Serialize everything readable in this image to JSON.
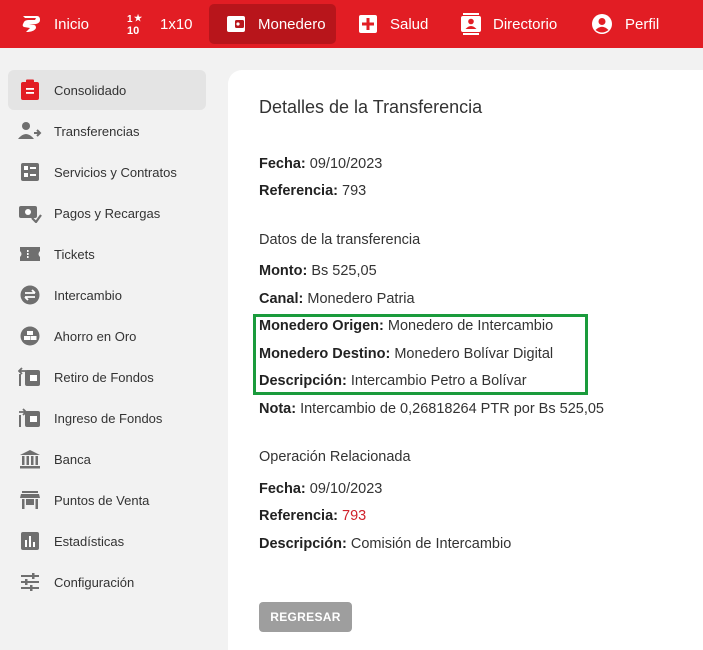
{
  "topnav": {
    "items": [
      {
        "label": "Inicio",
        "icon": "patria-logo-icon"
      },
      {
        "label": "1x10",
        "icon": "1x10-icon"
      },
      {
        "label": "Monedero",
        "icon": "wallet-icon",
        "active": true
      },
      {
        "label": "Salud",
        "icon": "health-cross-icon"
      },
      {
        "label": "Directorio",
        "icon": "contacts-icon"
      },
      {
        "label": "Perfil",
        "icon": "account-circle-icon"
      }
    ],
    "accent_color": "#e21d24",
    "active_color": "#b8151b"
  },
  "sidebar": {
    "items": [
      {
        "label": "Consolidado",
        "icon": "clipboard-icon",
        "active": true
      },
      {
        "label": "Transferencias",
        "icon": "person-transfer-icon"
      },
      {
        "label": "Servicios y Contratos",
        "icon": "list-grid-icon"
      },
      {
        "label": "Pagos y Recargas",
        "icon": "payment-icon"
      },
      {
        "label": "Tickets",
        "icon": "ticket-icon"
      },
      {
        "label": "Intercambio",
        "icon": "exchange-icon"
      },
      {
        "label": "Ahorro en Oro",
        "icon": "gold-savings-icon"
      },
      {
        "label": "Retiro de Fondos",
        "icon": "withdraw-icon"
      },
      {
        "label": "Ingreso de Fondos",
        "icon": "deposit-icon"
      },
      {
        "label": "Banca",
        "icon": "bank-icon"
      },
      {
        "label": "Puntos de Venta",
        "icon": "store-icon"
      },
      {
        "label": "Estadísticas",
        "icon": "stats-icon"
      },
      {
        "label": "Configuración",
        "icon": "settings-sliders-icon"
      }
    ]
  },
  "detail": {
    "title": "Detalles de la Transferencia",
    "fecha_label": "Fecha:",
    "fecha_value": "09/10/2023",
    "referencia_label": "Referencia:",
    "referencia_value": "793",
    "datos_heading": "Datos de la transferencia",
    "monto_label": "Monto:",
    "monto_value": "Bs 525,05",
    "canal_label": "Canal:",
    "canal_value": "Monedero Patria",
    "origen_label": "Monedero Origen:",
    "origen_value": "Monedero de Intercambio",
    "destino_label": "Monedero Destino:",
    "destino_value": "Monedero Bolívar Digital",
    "descripcion_label": "Descripción:",
    "descripcion_value": "Intercambio Petro a Bolívar",
    "nota_label": "Nota:",
    "nota_value": "Intercambio de 0,26818264 PTR por Bs 525,05",
    "operacion_heading": "Operación Relacionada",
    "op_fecha_label": "Fecha:",
    "op_fecha_value": "09/10/2023",
    "op_referencia_label": "Referencia:",
    "op_referencia_value": "793",
    "op_descripcion_label": "Descripción:",
    "op_descripcion_value": "Comisión de Intercambio",
    "back_button": "REGRESAR",
    "highlight_color": "#1a9b3c"
  }
}
